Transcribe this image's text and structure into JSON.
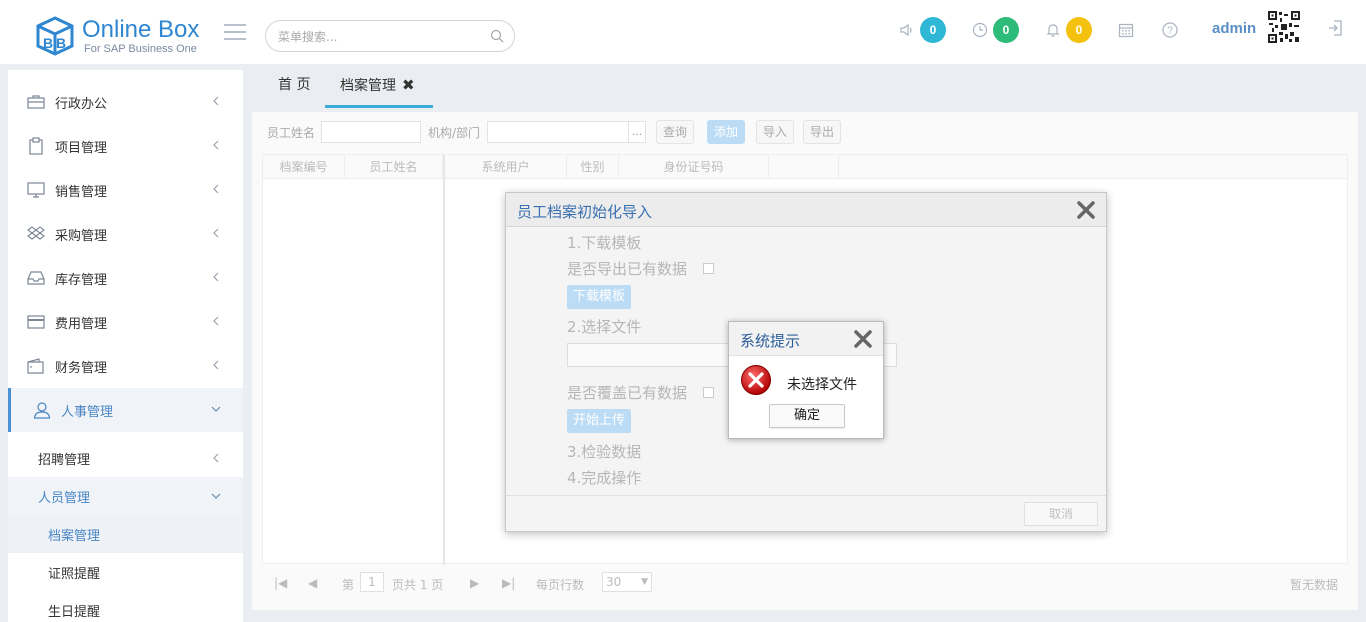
{
  "header": {
    "logo_name": "Online Box",
    "logo_sub": "For SAP Business One",
    "search_placeholder": "菜单搜索...",
    "badges": [
      {
        "icon": "speaker-icon",
        "count": "0",
        "color": "#2fb8d6"
      },
      {
        "icon": "clock-icon",
        "count": "0",
        "color": "#2dbb7a"
      },
      {
        "icon": "bell-icon",
        "count": "0",
        "color": "#f5c10f"
      }
    ],
    "user": "admin"
  },
  "sidebar": {
    "items": [
      {
        "label": "行政办公",
        "icon": "briefcase-icon"
      },
      {
        "label": "项目管理",
        "icon": "clipboard-icon"
      },
      {
        "label": "销售管理",
        "icon": "monitor-icon"
      },
      {
        "label": "采购管理",
        "icon": "dropbox-icon"
      },
      {
        "label": "库存管理",
        "icon": "inbox-icon"
      },
      {
        "label": "费用管理",
        "icon": "credit-card-icon"
      },
      {
        "label": "财务管理",
        "icon": "wallet-icon"
      },
      {
        "label": "人事管理",
        "icon": "user-icon"
      }
    ],
    "sub_items": [
      {
        "label": "招聘管理"
      },
      {
        "label": "人员管理"
      }
    ],
    "leaves": [
      {
        "label": "档案管理"
      },
      {
        "label": "证照提醒"
      },
      {
        "label": "生日提醒"
      }
    ]
  },
  "tabs": [
    {
      "label": "首 页"
    },
    {
      "label": "档案管理",
      "close": "✖"
    }
  ],
  "toolbar": {
    "name_label": "员工姓名",
    "dept_label": "机构/部门",
    "dept_picker": "...",
    "query": "查询",
    "add": "添加",
    "import": "导入",
    "export": "导出"
  },
  "grid": {
    "columns": [
      "档案编号",
      "员工姓名",
      "系统用户",
      "性别",
      "身份证号码"
    ]
  },
  "pager": {
    "page_prefix": "第",
    "page_value": "1",
    "page_suffix": "页共 1 页",
    "rows_label": "每页行数",
    "rows_value": "30",
    "empty": "暂无数据"
  },
  "dialog": {
    "title": "员工档案初始化导入",
    "step1": "1.下载模板",
    "export_existing": "是否导出已有数据",
    "download_btn": "下载模板",
    "step2": "2.选择文件",
    "overwrite": "是否覆盖已有数据",
    "upload_btn": "开始上传",
    "step3": "3.检验数据",
    "step4": "4.完成操作",
    "cancel": "取消"
  },
  "alert": {
    "title": "系统提示",
    "message": "未选择文件",
    "ok": "确定"
  }
}
